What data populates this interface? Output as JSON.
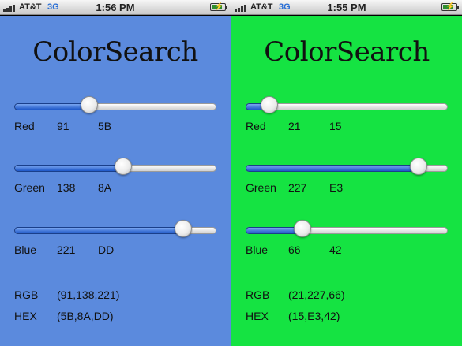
{
  "screens": [
    {
      "status": {
        "carrier": "AT&T",
        "network": "3G",
        "time": "1:56 PM"
      },
      "background": "#5b8add",
      "title": "ColorSearch",
      "channels": [
        {
          "label": "Red",
          "decimal": "91",
          "hex": "5B",
          "slider_value": 0.357
        },
        {
          "label": "Green",
          "decimal": "138",
          "hex": "8A",
          "slider_value": 0.541
        },
        {
          "label": "Blue",
          "decimal": "221",
          "hex": "DD",
          "slider_value": 0.867
        }
      ],
      "rgb_label": "RGB",
      "rgb_value": "(91,138,221)",
      "hex_label": "HEX",
      "hex_value": "(5B,8A,DD)"
    },
    {
      "status": {
        "carrier": "AT&T",
        "network": "3G",
        "time": "1:55 PM"
      },
      "background": "#15e342",
      "title": "ColorSearch",
      "channels": [
        {
          "label": "Red",
          "decimal": "21",
          "hex": "15",
          "slider_value": 0.082
        },
        {
          "label": "Green",
          "decimal": "227",
          "hex": "E3",
          "slider_value": 0.89
        },
        {
          "label": "Blue",
          "decimal": "66",
          "hex": "42",
          "slider_value": 0.259
        }
      ],
      "rgb_label": "RGB",
      "rgb_value": "(21,227,66)",
      "hex_label": "HEX",
      "hex_value": "(15,E3,42)"
    }
  ]
}
